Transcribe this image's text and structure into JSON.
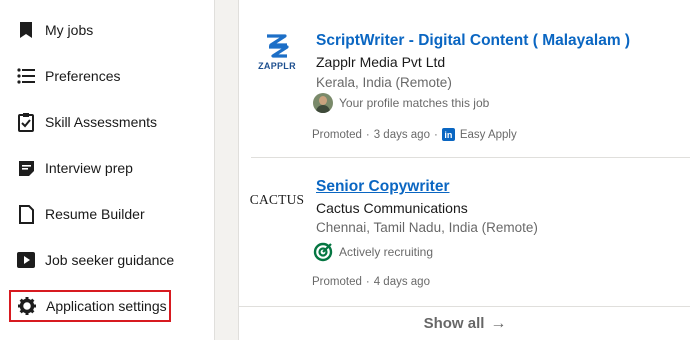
{
  "sidebar": {
    "items": [
      {
        "label": "My jobs",
        "icon": "bookmark-icon"
      },
      {
        "label": "Preferences",
        "icon": "list-icon"
      },
      {
        "label": "Skill Assessments",
        "icon": "clipboard-check-icon"
      },
      {
        "label": "Interview prep",
        "icon": "note-icon"
      },
      {
        "label": "Resume Builder",
        "icon": "document-icon"
      },
      {
        "label": "Job seeker guidance",
        "icon": "video-icon"
      },
      {
        "label": "Application settings",
        "icon": "gear-icon"
      }
    ]
  },
  "jobs": [
    {
      "logo_text": "ZAPPLR",
      "title": "ScriptWriter - Digital Content ( Malayalam )",
      "company": "Zapplr Media Pvt Ltd",
      "location": "Kerala, India (Remote)",
      "insight": "Your profile matches this job",
      "promoted": "Promoted",
      "posted": "3 days ago",
      "easy_apply": "Easy Apply",
      "li_badge": "in"
    },
    {
      "logo_text": "CACTUS",
      "title": "Senior Copywriter",
      "company": "Cactus Communications",
      "location": "Chennai, Tamil Nadu, India (Remote)",
      "insight": "Actively recruiting",
      "promoted": "Promoted",
      "posted": "4 days ago"
    }
  ],
  "show_all": {
    "label": "Show all",
    "arrow": "→"
  },
  "colors": {
    "accent": "#0a66c2",
    "highlight_border": "#d71a20",
    "recruiting_green": "#057642"
  }
}
